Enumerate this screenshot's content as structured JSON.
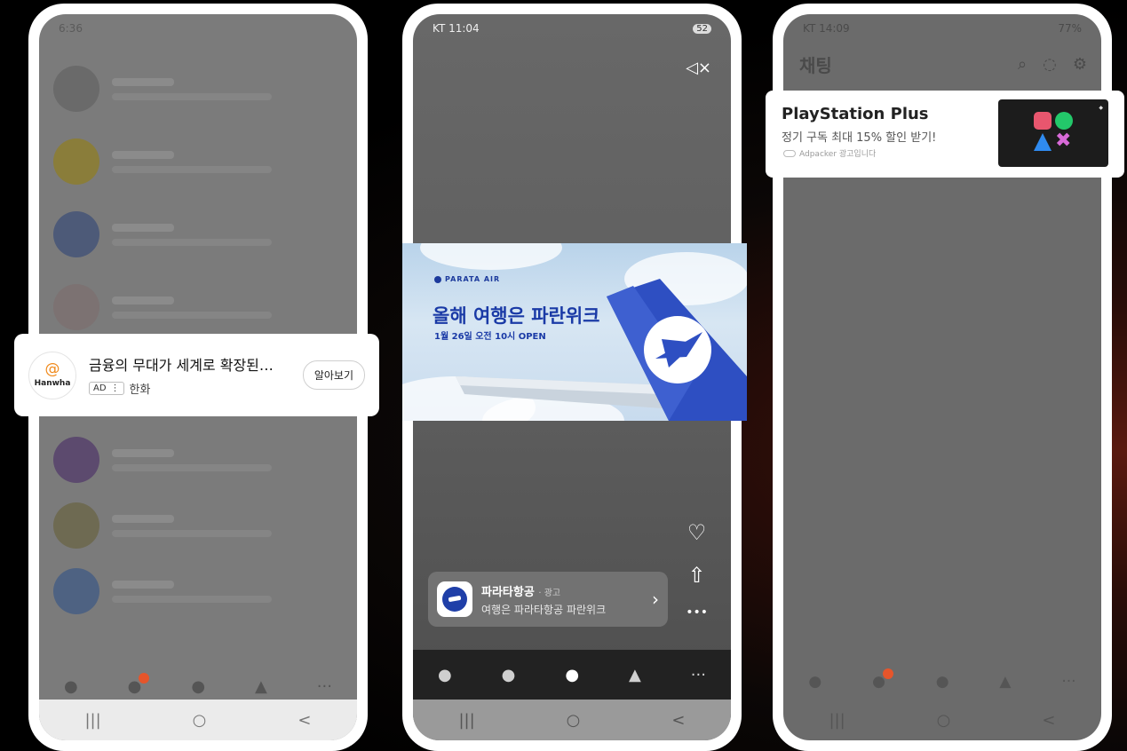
{
  "colors": {
    "kakao_badge": "#e6552b",
    "parata_blue": "#1a3aa6",
    "hanwha_orange": "#f08a1c"
  },
  "phone1": {
    "status": {
      "time": "6:36",
      "right": ""
    },
    "ad": {
      "logo_text": "Hanwha",
      "title": "금융의 무대가 세계로 확장된…",
      "ad_tag": "AD",
      "ad_menu": "⋮",
      "advertiser": "한화",
      "cta": "알아보기"
    },
    "sysnav": {
      "recent": "|||",
      "home": "○",
      "back": "<"
    }
  },
  "phone2": {
    "status": {
      "time": "KT 11:04",
      "right": "52"
    },
    "banner": {
      "brand": "PARATA AIR",
      "headline": "올해 여행은 파란위크",
      "subline": "1월 26일 오전 10시 OPEN"
    },
    "sponsor": {
      "name": "파라타항공",
      "tag": "· 광고",
      "desc": "여행은 파라타항공 파란위크"
    },
    "icons": {
      "mute": "◁×",
      "like": "♡",
      "share": "⇧",
      "more": "•••"
    },
    "sysnav": {
      "recent": "|||",
      "home": "○",
      "back": "<"
    }
  },
  "phone3": {
    "status": {
      "time": "KT 14:09",
      "right": "77%"
    },
    "title": "채팅",
    "ad": {
      "title": "PlayStation Plus",
      "subtitle": "정기 구독 최대 15% 할인 받기!",
      "source": "Adpacker 광고입니다"
    },
    "sysnav": {
      "recent": "|||",
      "home": "○",
      "back": "<"
    }
  }
}
